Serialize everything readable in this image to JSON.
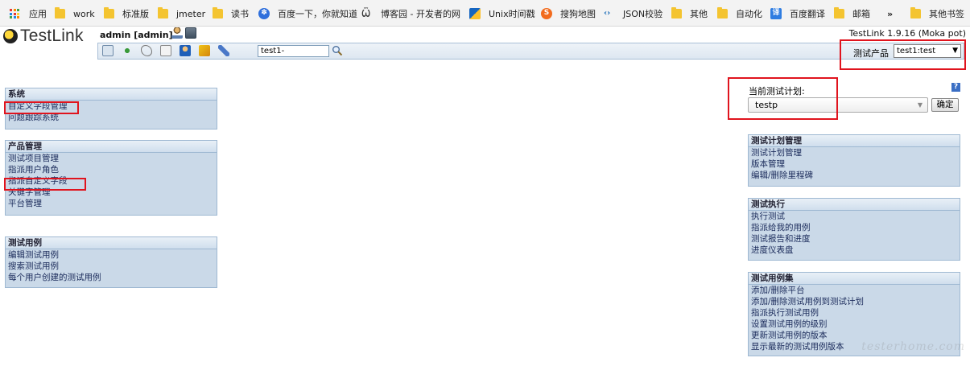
{
  "bookmarks": [
    {
      "label": "应用",
      "icon": "apps-icon"
    },
    {
      "label": "work",
      "icon": "folder-icon"
    },
    {
      "label": "标准版",
      "icon": "folder-icon"
    },
    {
      "label": "jmeter",
      "icon": "folder-icon"
    },
    {
      "label": "读书",
      "icon": "folder-icon"
    },
    {
      "label": "百度一下，你就知道",
      "icon": "baidu-paw-icon"
    },
    {
      "label": "博客园 - 开发者的网",
      "icon": "cnblogs-icon"
    },
    {
      "label": "Unix时间戳",
      "icon": "unix-timestamp-icon"
    },
    {
      "label": "搜狗地图",
      "icon": "sogou-icon"
    },
    {
      "label": "JSON校验",
      "icon": "json-icon"
    },
    {
      "label": "其他",
      "icon": "folder-icon"
    },
    {
      "label": "自动化",
      "icon": "folder-icon"
    },
    {
      "label": "百度翻译",
      "icon": "translate-icon"
    },
    {
      "label": "邮箱",
      "icon": "folder-icon"
    },
    {
      "label": "»",
      "icon": ""
    },
    {
      "label": "其他书签",
      "icon": "folder-icon"
    }
  ],
  "header": {
    "logo_text": "TestLink",
    "user": "admin [admin]",
    "version": "TestLink 1.9.16 (Moka pot)"
  },
  "toolbar": {
    "search_value": "test1-",
    "product_label": "测试产品",
    "product_value": "test1:test"
  },
  "left_menus": [
    {
      "title": "系统",
      "items": [
        "自定义字段管理",
        "问题跟踪系统"
      ]
    },
    {
      "title": "产品管理",
      "items": [
        "测试项目管理",
        "指派用户角色",
        "指派自定义字段",
        "关键字管理",
        "平台管理"
      ]
    },
    {
      "title": "测试用例",
      "items": [
        "编辑测试用例",
        "搜索测试用例",
        "每个用户创建的测试用例"
      ]
    }
  ],
  "plan": {
    "label": "当前测试计划:",
    "value": "testp",
    "ok_label": "确定",
    "help": "?"
  },
  "right_menus": [
    {
      "title": "测试计划管理",
      "items": [
        "测试计划管理",
        "版本管理",
        "编辑/删除里程碑"
      ]
    },
    {
      "title": "测试执行",
      "items": [
        "执行测试",
        "指派给我的用例",
        "测试报告和进度",
        "进度仪表盘"
      ]
    },
    {
      "title": "测试用例集",
      "items": [
        "添加/删除平台",
        "添加/删除测试用例到测试计划",
        "指派执行测试用例",
        "设置测试用例的级别",
        "更新测试用例的版本",
        "显示最新的测试用例版本"
      ]
    }
  ],
  "watermark": "testerhome.com",
  "colors": {
    "menu_bg": "#cad9e8",
    "highlight_red": "#e0141e",
    "link": "#1a2a5a"
  }
}
